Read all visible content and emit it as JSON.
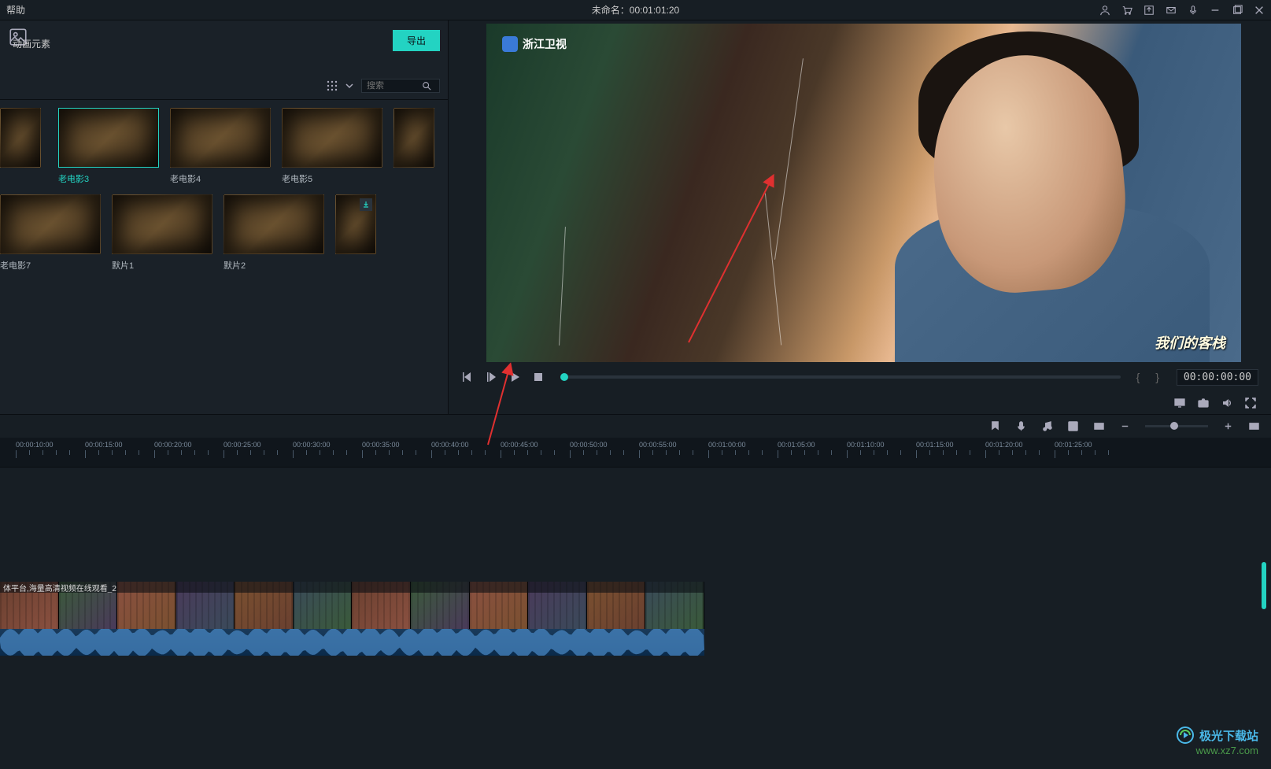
{
  "menubar": {
    "help": "帮助",
    "title_prefix": "未命名：",
    "timecode": "00:01:01:20"
  },
  "panel": {
    "tab": "动画元素",
    "export": "导出",
    "search_placeholder": "搜索"
  },
  "thumbs": [
    {
      "label": ""
    },
    {
      "label": "老电影3",
      "selected": true
    },
    {
      "label": "老电影4"
    },
    {
      "label": "老电影5"
    },
    {
      "label": ""
    },
    {
      "label": "老电影7"
    },
    {
      "label": "默片1"
    },
    {
      "label": "默片2"
    },
    {
      "label": "",
      "download": true
    }
  ],
  "preview": {
    "channel": "浙江卫视",
    "show": "我们的客栈",
    "timecode": "00:00:00:00",
    "brackets": "{  }"
  },
  "ruler": [
    "00:00:10:00",
    "00:00:15:00",
    "00:00:20:00",
    "00:00:25:00",
    "00:00:30:00",
    "00:00:35:00",
    "00:00:40:00",
    "00:00:45:00",
    "00:00:50:00",
    "00:00:55:00",
    "00:01:00:00",
    "00:01:05:00",
    "00:01:10:00",
    "00:01:15:00",
    "00:01:20:00",
    "00:01:25:00"
  ],
  "clip": {
    "title": "体平台,海量高清视频在线观看_2"
  },
  "watermark": {
    "name": "极光下载站",
    "url": "www.xz7.com"
  }
}
